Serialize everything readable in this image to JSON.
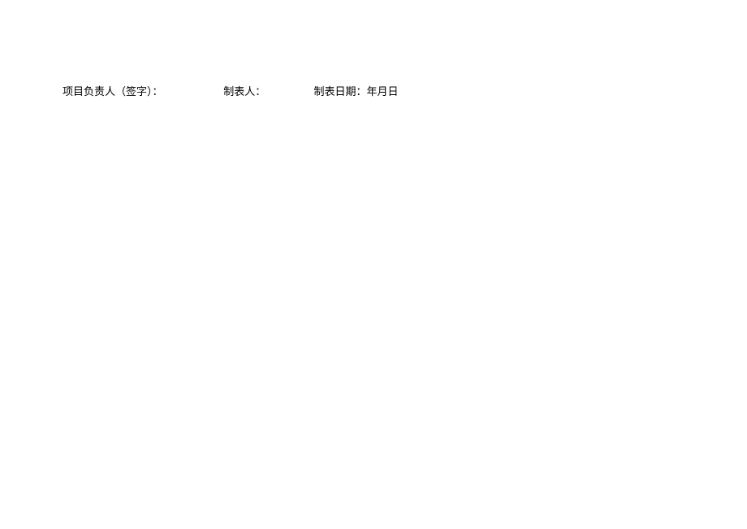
{
  "signature_row": {
    "project_leader_label": "项目负责人（签字）：",
    "preparer_label": "制表人：",
    "date_label": "制表日期：年月日"
  }
}
